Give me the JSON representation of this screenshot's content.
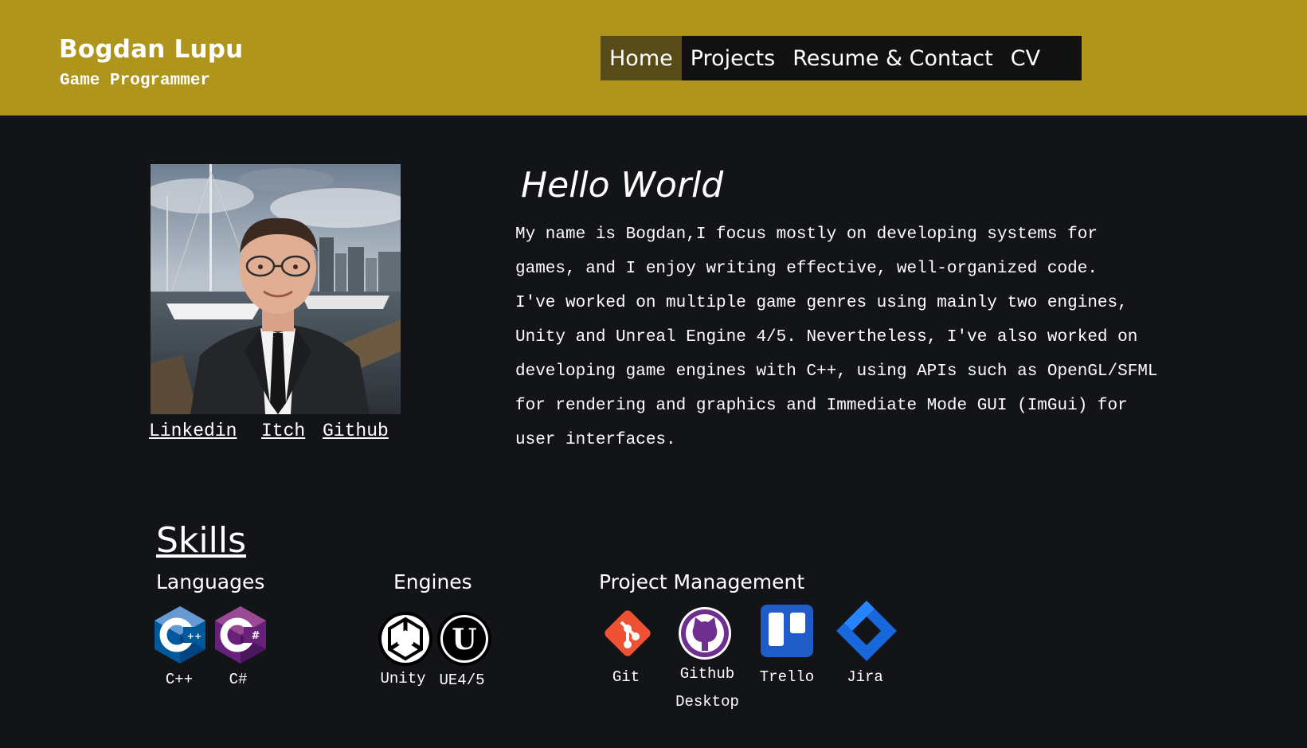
{
  "header": {
    "name": "Bogdan Lupu",
    "role": "Game Programmer",
    "background_color": "#b0951c"
  },
  "nav": {
    "items": [
      "Home",
      "Projects",
      "Resume & Contact",
      "CV"
    ],
    "active": "Home"
  },
  "profile": {
    "photo_icon": "profile-photo",
    "links": [
      "Linkedin",
      "Itch",
      "Github"
    ]
  },
  "intro": {
    "heading": "Hello World",
    "lines": [
      "My name is Bogdan,I focus mostly on developing systems for",
      "games, and I enjoy writing effective, well-organized code.",
      "I've worked on multiple game genres using mainly two engines,",
      "Unity and Unreal Engine 4/5. Nevertheless, I've also worked on",
      "developing game engines with C++, using APIs such as OpenGL/SFML",
      "for rendering and graphics and Immediate Mode GUI (ImGui) for",
      "user interfaces."
    ]
  },
  "skills": {
    "title": "Skills",
    "languages": {
      "title": "Languages",
      "items": [
        {
          "label": "C++",
          "icon": "cpp-icon"
        },
        {
          "label": "C#",
          "icon": "csharp-icon"
        }
      ]
    },
    "engines": {
      "title": "Engines",
      "items": [
        {
          "label": "Unity",
          "icon": "unity-icon"
        },
        {
          "label": "UE4/5",
          "icon": "unreal-icon"
        }
      ]
    },
    "project_management": {
      "title": "Project Management",
      "items": [
        {
          "label": "Git",
          "icon": "git-icon"
        },
        {
          "label": "Github Desktop",
          "label_line1": "Github",
          "label_line2": "Desktop",
          "icon": "github-desktop-icon"
        },
        {
          "label": "Trello",
          "icon": "trello-icon"
        },
        {
          "label": "Jira",
          "icon": "jira-icon"
        }
      ]
    }
  }
}
